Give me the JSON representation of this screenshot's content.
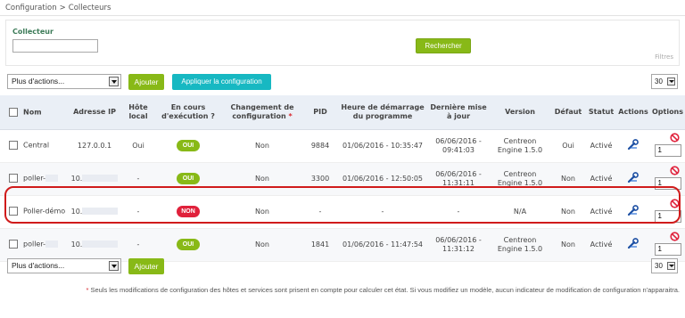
{
  "breadcrumb": {
    "parent": "Configuration",
    "separator": ">",
    "current": "Collecteurs"
  },
  "filter": {
    "label": "Collecteur",
    "value": "",
    "search_label": "Rechercher",
    "filters_link": "Filtres"
  },
  "toolbar_top": {
    "more_actions": "Plus d'actions...",
    "add": "Ajouter",
    "apply": "Appliquer la configuration",
    "limit": "30"
  },
  "toolbar_bottom": {
    "more_actions": "Plus d'actions...",
    "add": "Ajouter",
    "limit": "30"
  },
  "columns": {
    "name": "Nom",
    "ip": "Adresse IP",
    "localhost": "Hôte local",
    "running": "En cours d'exécution ?",
    "config_change": "Changement de configuration",
    "config_change_marker": "*",
    "pid": "PID",
    "start_time": "Heure de démarrage du programme",
    "last_update": "Dernière mise à jour",
    "version": "Version",
    "default": "Défaut",
    "status": "Statut",
    "actions": "Actions",
    "options": "Options"
  },
  "rows": [
    {
      "name": "Central",
      "ip": "127.0.0.1",
      "localhost": "Oui",
      "running": "OUI",
      "config_change": "Non",
      "pid": "9884",
      "start_time": "01/06/2016 - 10:35:47",
      "last_update_date": "06/06/2016 -",
      "last_update_time": "09:41:03",
      "version_1": "Centreon",
      "version_2": "Engine 1.5.0",
      "default": "Oui",
      "status": "Activé",
      "option_value": "1"
    },
    {
      "name": "poller-",
      "ip": "10.",
      "localhost": "-",
      "running": "OUI",
      "config_change": "Non",
      "pid": "3300",
      "start_time": "01/06/2016 - 12:50:05",
      "last_update_date": "06/06/2016 -",
      "last_update_time": "11:31:11",
      "version_1": "Centreon",
      "version_2": "Engine 1.5.0",
      "default": "Non",
      "status": "Activé",
      "option_value": "1"
    },
    {
      "name": "Poller-démo",
      "ip": "10.",
      "localhost": "-",
      "running": "NON",
      "config_change": "Non",
      "pid": "-",
      "start_time": "-",
      "last_update_date": "-",
      "last_update_time": "",
      "version_1": "N/A",
      "version_2": "",
      "default": "Non",
      "status": "Activé",
      "option_value": "1"
    },
    {
      "name": "poller-",
      "ip": "10.",
      "localhost": "-",
      "running": "OUI",
      "config_change": "Non",
      "pid": "1841",
      "start_time": "01/06/2016 - 11:47:54",
      "last_update_date": "06/06/2016 -",
      "last_update_time": "11:31:12",
      "version_1": "Centreon",
      "version_2": "Engine 1.5.0",
      "default": "Non",
      "status": "Activé",
      "option_value": "1"
    }
  ],
  "footnote": {
    "marker": "*",
    "text": " Seuls les modifications de configuration des hôtes et services sont prisent en compte pour calculer cet état. Si vous modifiez un modèle, aucun indicateur de modification de configuration n'apparaitra."
  },
  "colors": {
    "green": "#88b917",
    "teal": "#17b8c2",
    "red": "#e0213b",
    "header_bg": "#eaeff6",
    "highlight": "#d01b1b"
  },
  "icons": {
    "actions": "wrench-pencil-icon",
    "options": "ban-icon",
    "select_arrow": "chevron-down-icon"
  }
}
